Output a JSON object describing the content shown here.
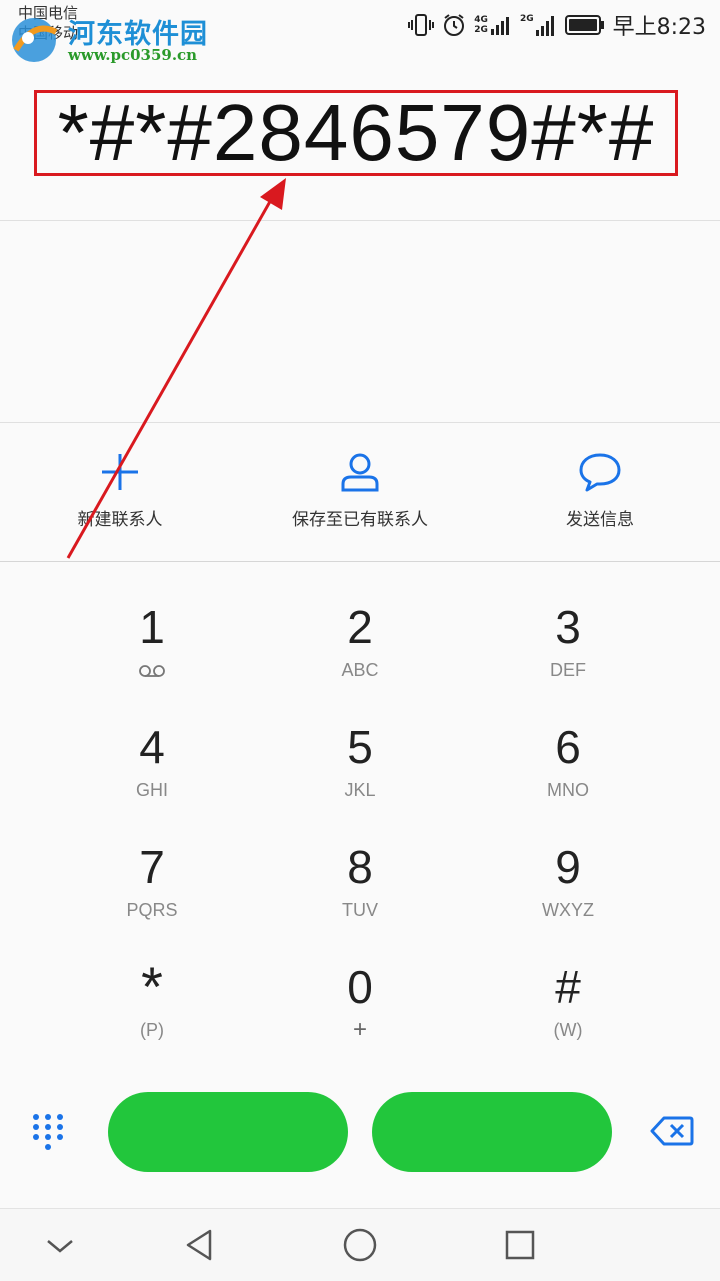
{
  "status_bar": {
    "carrier1": "中国电信",
    "carrier2": "中国移动",
    "net1": "4G",
    "net2": "2G",
    "net3": "2G",
    "time": "早上8:23"
  },
  "watermark": {
    "title": "河东软件园",
    "url": "www.pc0359.cn"
  },
  "dialer": {
    "number": "*#*#2846579#*#"
  },
  "actions": [
    {
      "label": "新建联系人",
      "icon": "plus-icon"
    },
    {
      "label": "保存至已有联系人",
      "icon": "person-icon"
    },
    {
      "label": "发送信息",
      "icon": "message-icon"
    }
  ],
  "keypad": [
    {
      "digit": "1",
      "sub": ""
    },
    {
      "digit": "2",
      "sub": "ABC"
    },
    {
      "digit": "3",
      "sub": "DEF"
    },
    {
      "digit": "4",
      "sub": "GHI"
    },
    {
      "digit": "5",
      "sub": "JKL"
    },
    {
      "digit": "6",
      "sub": "MNO"
    },
    {
      "digit": "7",
      "sub": "PQRS"
    },
    {
      "digit": "8",
      "sub": "TUV"
    },
    {
      "digit": "9",
      "sub": "WXYZ"
    },
    {
      "digit": "*",
      "sub": "(P)"
    },
    {
      "digit": "0",
      "sub": "+"
    },
    {
      "digit": "#",
      "sub": "(W)"
    }
  ],
  "colors": {
    "accent_blue": "#1a73e8",
    "call_green": "#22c63c",
    "annotation_red": "#d9191f"
  }
}
